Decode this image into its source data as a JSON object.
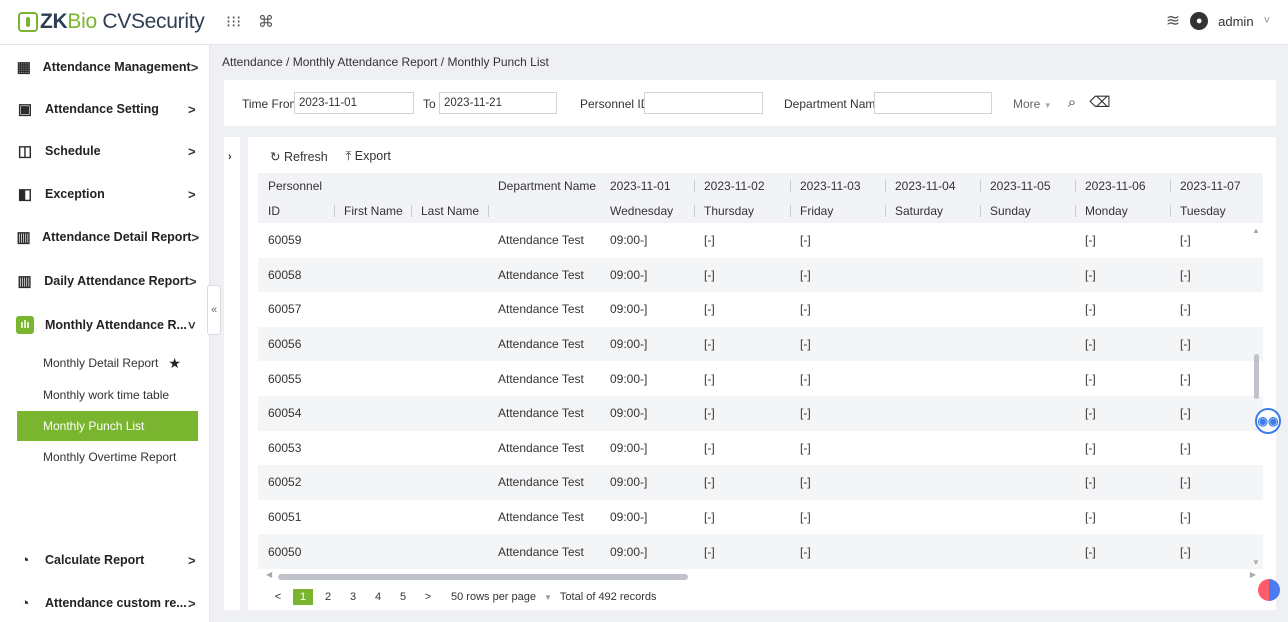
{
  "app": {
    "logo_zk": "ZK",
    "logo_bio": "Bio",
    "logo_cv": " CVSecurity",
    "apps_icon": "grid-dots-icon",
    "cmd_icon": "command-icon",
    "user_label": "admin",
    "user_caret": "˅"
  },
  "sidebar": {
    "items": [
      {
        "label": "Attendance Management",
        "chevron": ">",
        "icon": "calendar-icon"
      },
      {
        "label": "Attendance Setting",
        "chevron": ">",
        "icon": "settings-icon"
      },
      {
        "label": "Schedule",
        "chevron": ">",
        "icon": "schedule-icon"
      },
      {
        "label": "Exception",
        "chevron": ">",
        "icon": "exception-icon"
      },
      {
        "label": "Attendance Detail Report",
        "chevron": ">",
        "icon": "bar-chart-icon"
      },
      {
        "label": "Daily Attendance Report",
        "chevron": ">",
        "icon": "bar-chart-icon"
      },
      {
        "label": "Monthly Attendance R...",
        "chevron": "˅",
        "icon": "bar-chart-icon"
      },
      {
        "label": "Calculate Report",
        "chevron": ">",
        "icon": "pie-chart-icon"
      },
      {
        "label": "Attendance custom re...",
        "chevron": ">",
        "icon": "pie-chart-icon"
      }
    ],
    "sub_items": [
      {
        "label": "Monthly Detail Report",
        "starred": true
      },
      {
        "label": "Monthly work time table"
      },
      {
        "label": "Monthly Punch List",
        "selected": true
      },
      {
        "label": "Monthly Overtime Report"
      }
    ],
    "collapse_label": "«"
  },
  "breadcrumb": "Attendance / Monthly Attendance Report / Monthly Punch List",
  "filter": {
    "time_from_label": "Time From",
    "time_from_value": "2023-11-01",
    "to_label": "To",
    "to_value": "2023-11-21",
    "personnel_id_label": "Personnel ID",
    "personnel_id_value": "",
    "department_label": "Department Name",
    "department_value": "",
    "more_label": "More"
  },
  "toolbar": {
    "refresh_label": "Refresh",
    "export_label": "Export"
  },
  "table": {
    "header_row1": [
      "Personnel",
      "",
      "",
      "Department Name",
      "2023-11-01",
      "2023-11-02",
      "2023-11-03",
      "2023-11-04",
      "2023-11-05",
      "2023-11-06",
      "2023-11-07"
    ],
    "header_row2": [
      "ID",
      "First Name",
      "Last Name",
      "",
      "Wednesday",
      "Thursday",
      "Friday",
      "Saturday",
      "Sunday",
      "Monday",
      "Tuesday"
    ],
    "rows": [
      [
        "60059",
        "",
        "",
        "Attendance Test",
        "09:00-]",
        "[-]",
        "[-]",
        "",
        "",
        "[-]",
        "[-]"
      ],
      [
        "60058",
        "",
        "",
        "Attendance Test",
        "09:00-]",
        "[-]",
        "[-]",
        "",
        "",
        "[-]",
        "[-]"
      ],
      [
        "60057",
        "",
        "",
        "Attendance Test",
        "09:00-]",
        "[-]",
        "[-]",
        "",
        "",
        "[-]",
        "[-]"
      ],
      [
        "60056",
        "",
        "",
        "Attendance Test",
        "09:00-]",
        "[-]",
        "[-]",
        "",
        "",
        "[-]",
        "[-]"
      ],
      [
        "60055",
        "",
        "",
        "Attendance Test",
        "09:00-]",
        "[-]",
        "[-]",
        "",
        "",
        "[-]",
        "[-]"
      ],
      [
        "60054",
        "",
        "",
        "Attendance Test",
        "09:00-]",
        "[-]",
        "[-]",
        "",
        "",
        "[-]",
        "[-]"
      ],
      [
        "60053",
        "",
        "",
        "Attendance Test",
        "09:00-]",
        "[-]",
        "[-]",
        "",
        "",
        "[-]",
        "[-]"
      ],
      [
        "60052",
        "",
        "",
        "Attendance Test",
        "09:00-]",
        "[-]",
        "[-]",
        "",
        "",
        "[-]",
        "[-]"
      ],
      [
        "60051",
        "",
        "",
        "Attendance Test",
        "09:00-]",
        "[-]",
        "[-]",
        "",
        "",
        "[-]",
        "[-]"
      ],
      [
        "60050",
        "",
        "",
        "Attendance Test",
        "09:00-]",
        "[-]",
        "[-]",
        "",
        "",
        "[-]",
        "[-]"
      ]
    ]
  },
  "pagination": {
    "prev": "<",
    "pages": [
      "1",
      "2",
      "3",
      "4",
      "5"
    ],
    "current": "1",
    "next": ">",
    "rows_per_page": "50 rows per page",
    "total": "Total of 492 records"
  },
  "colors": {
    "accent": "#7ab52f",
    "logo_dark": "#2e3e52",
    "background": "#eef0f4"
  }
}
